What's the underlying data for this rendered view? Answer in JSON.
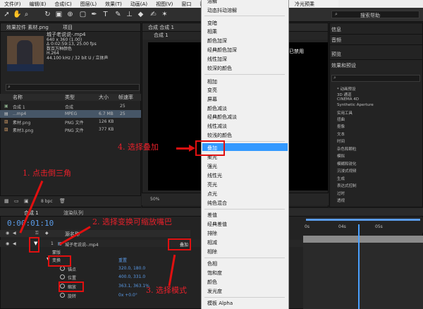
{
  "menubar": [
    "文件(F)",
    "编辑(E)",
    "合成(C)",
    "图层(L)",
    "效果(T)",
    "动画(A)",
    "视图(V)",
    "窗口",
    "帮助(H)"
  ],
  "search_help": "搜索帮助",
  "project": {
    "tab": "效果控件 素材.png",
    "tab2": "项目",
    "meta": [
      "城子老说说-.mp4",
      "640 x 360 (1.00)",
      "Δ 0:02:59:13, 25.00 fps",
      "数百万种颜色",
      "H.264",
      "44.100 kHz / 32 bit U / 立体声"
    ],
    "columns": [
      "名称",
      "类型",
      "大小",
      "帧速率"
    ],
    "rows": [
      {
        "name": "合成 1",
        "type": "合成",
        "size": "",
        "fps": "25"
      },
      {
        "name": "...mp4",
        "type": "MPEG",
        "size": "6.7 MB",
        "fps": "25"
      },
      {
        "name": "素材.png",
        "type": "PNG 文件",
        "size": "126 KB",
        "fps": ""
      },
      {
        "name": "素材3.png",
        "type": "PNG 文件",
        "size": "377 KB",
        "fps": ""
      }
    ],
    "bpc": "8 bpc"
  },
  "viewer": {
    "tab": "合成 合成 1",
    "subtab": "合成 1",
    "overlay": "已禁用",
    "zoom": "50%"
  },
  "right": {
    "info": "信息",
    "audio": "音频",
    "preview": "预览",
    "effects": "效果和预设",
    "fx_items": [
      "* 动画预设",
      "3D 通道",
      "CINEMA 4D",
      "Synthetic Aperture",
      "实用工具",
      "扭曲",
      "抠像",
      "文本",
      "时间",
      "杂色和颗粒",
      "模拟",
      "模糊和锐化",
      "沉浸式视频",
      "生成",
      "表达式控制",
      "过时",
      "透视"
    ]
  },
  "timeline": {
    "tab": "合成 1",
    "render": "渲染队列",
    "timecode": "0:00:01:10",
    "source_col": "源名称",
    "layer_num": "1",
    "layer_name": "城子老说说-.mp4",
    "mode_value": "叠加",
    "props": [
      "蒙版",
      "变换",
      "锚点",
      "位置",
      "缩放",
      "旋转"
    ],
    "values": [
      "重置",
      "320.0, 180.0",
      "400.0, 331.0",
      "363.1, 363.1%",
      "0x +0.0°"
    ],
    "ruler": [
      "0s",
      "04s",
      "05s"
    ]
  },
  "blend_menu": {
    "top": [
      "溶解",
      "动态抖动溶解"
    ],
    "g1": [
      "变暗",
      "相乘",
      "颜色加深",
      "经典颜色加深",
      "线性加深",
      "较深的颜色"
    ],
    "g2": [
      "相加",
      "变亮",
      "屏幕",
      "颜色减淡",
      "经典颜色减淡",
      "线性减淡",
      "较浅的颜色"
    ],
    "selected": "叠加",
    "g3": [
      "柔光",
      "强光",
      "线性光",
      "亮光",
      "点光",
      "纯色混合"
    ],
    "g4": [
      "差值",
      "经典差值",
      "排除",
      "相减",
      "相除"
    ],
    "g5": [
      "色相",
      "饱和度",
      "颜色",
      "发光度"
    ],
    "g6": [
      "模板 Alpha"
    ],
    "peek": "冷光预乘"
  },
  "annotations": {
    "a1": "1. 点击倒三角",
    "a2": "2. 选择变换可缩放嘴巴",
    "a3": "3. 选择模式",
    "a4": "4. 选择叠加"
  },
  "colors": {
    "accent_blue": "#3399ff",
    "timecode_blue": "#5a9be8",
    "annotation_red": "#e01010"
  }
}
